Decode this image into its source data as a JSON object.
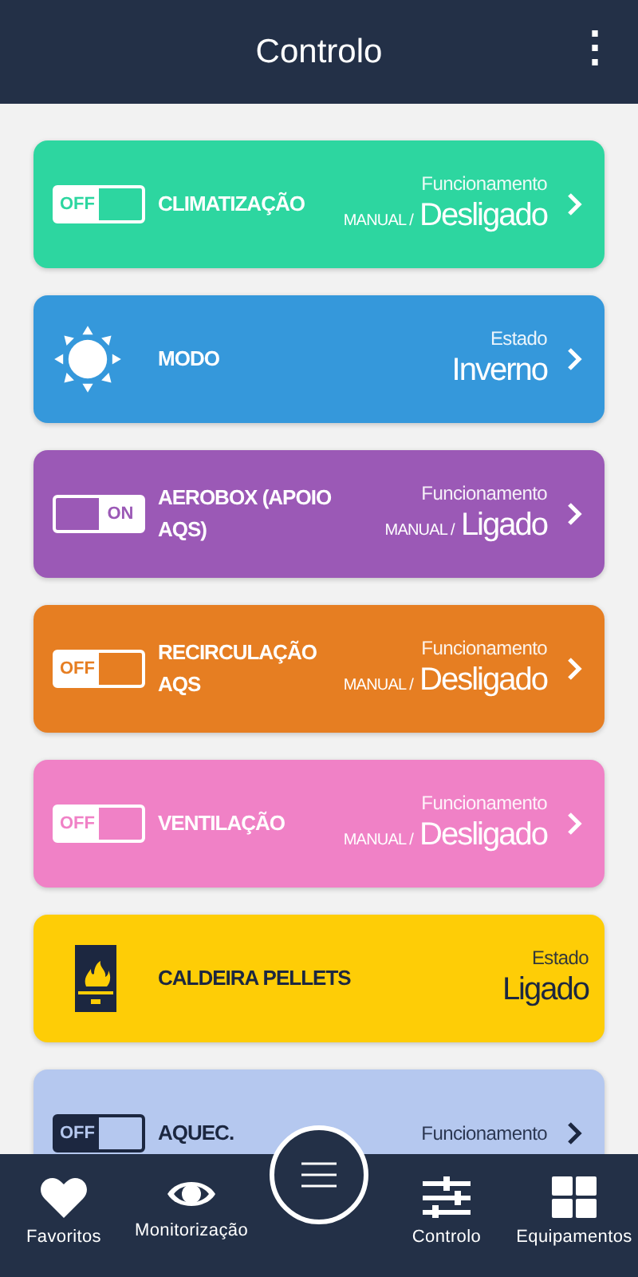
{
  "header": {
    "title": "Controlo",
    "menu_icon": "⋮"
  },
  "cards": [
    {
      "kind": "switch",
      "color": "#2dd6a0",
      "dark_text": false,
      "switch": {
        "on": false,
        "label": "OFF"
      },
      "name": "CLIMATIZAÇÃO",
      "status_label": "Funcionamento",
      "mode": "MANUAL /",
      "value": "Desligado",
      "chevron": true
    },
    {
      "kind": "sun",
      "color": "#3598db",
      "dark_text": false,
      "name": "MODO",
      "status_label": "Estado",
      "value": "Inverno",
      "chevron": true
    },
    {
      "kind": "switch",
      "color": "#9b59b6",
      "dark_text": false,
      "switch": {
        "on": true,
        "label": "ON"
      },
      "name": "AEROBOX (APOIO AQS)",
      "status_label": "Funcionamento",
      "mode": "MANUAL /",
      "value": "Ligado",
      "chevron": true
    },
    {
      "kind": "switch",
      "color": "#e67e22",
      "dark_text": false,
      "switch": {
        "on": false,
        "label": "OFF"
      },
      "name": "RECIRCULAÇÃO AQS",
      "status_label": "Funcionamento",
      "mode": "MANUAL /",
      "value": "Desligado",
      "chevron": true
    },
    {
      "kind": "switch",
      "color": "#f081c6",
      "dark_text": false,
      "switch": {
        "on": false,
        "label": "OFF"
      },
      "name": "VENTILAÇÃO",
      "status_label": "Funcionamento",
      "mode": "MANUAL /",
      "value": "Desligado",
      "chevron": true
    },
    {
      "kind": "boiler",
      "color": "#fecd06",
      "dark_text": true,
      "name": "CALDEIRA PELLETS",
      "status_label": "Estado",
      "value": "Ligado",
      "chevron": false
    },
    {
      "kind": "switch",
      "color": "#b5c8ef",
      "dark_text": true,
      "switch": {
        "on": false,
        "label": "OFF"
      },
      "name": "AQUEC.",
      "status_label": "Funcionamento",
      "chevron": true
    }
  ],
  "nav": [
    {
      "kind": "heart",
      "label": "Favoritos"
    },
    {
      "kind": "eye",
      "label": "Monitorização"
    },
    {
      "kind": "menu"
    },
    {
      "kind": "sliders",
      "label": "Controlo"
    },
    {
      "kind": "grid",
      "label": "Equipamentos"
    }
  ]
}
